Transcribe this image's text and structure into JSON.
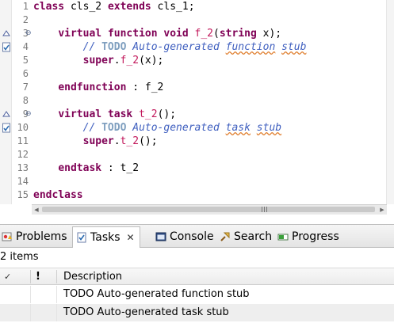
{
  "editor": {
    "lines": [
      {
        "n": "1",
        "segments": [
          {
            "t": "class",
            "c": "kw"
          },
          {
            "t": " cls_2 "
          },
          {
            "t": "extends",
            "c": "kw"
          },
          {
            "t": " cls_1;"
          }
        ]
      },
      {
        "n": "2",
        "segments": []
      },
      {
        "n": "3",
        "segments": [
          {
            "t": "    "
          },
          {
            "t": "virtual",
            "c": "kw"
          },
          {
            "t": " "
          },
          {
            "t": "function",
            "c": "kw"
          },
          {
            "t": " "
          },
          {
            "t": "void",
            "c": "kw"
          },
          {
            "t": " "
          },
          {
            "t": "f_2",
            "c": "fn"
          },
          {
            "t": "("
          },
          {
            "t": "string",
            "c": "kw"
          },
          {
            "t": " x);"
          }
        ]
      },
      {
        "n": "4",
        "segments": [
          {
            "t": "        "
          },
          {
            "t": "// ",
            "c": "cm"
          },
          {
            "t": "TODO",
            "c": "todo"
          },
          {
            "t": " Auto-generated ",
            "c": "cm"
          },
          {
            "t": "function",
            "c": "cm sq"
          },
          {
            "t": " ",
            "c": "cm"
          },
          {
            "t": "stub",
            "c": "cm sq"
          }
        ]
      },
      {
        "n": "5",
        "segments": [
          {
            "t": "        "
          },
          {
            "t": "super",
            "c": "kw"
          },
          {
            "t": "."
          },
          {
            "t": "f_2",
            "c": "fn"
          },
          {
            "t": "(x);"
          }
        ]
      },
      {
        "n": "6",
        "segments": []
      },
      {
        "n": "7",
        "segments": [
          {
            "t": "    "
          },
          {
            "t": "endfunction",
            "c": "kw"
          },
          {
            "t": " : f_2"
          }
        ]
      },
      {
        "n": "8",
        "segments": []
      },
      {
        "n": "9",
        "segments": [
          {
            "t": "    "
          },
          {
            "t": "virtual",
            "c": "kw"
          },
          {
            "t": " "
          },
          {
            "t": "task",
            "c": "kw"
          },
          {
            "t": " "
          },
          {
            "t": "t_2",
            "c": "fn"
          },
          {
            "t": "();"
          }
        ]
      },
      {
        "n": "10",
        "segments": [
          {
            "t": "        "
          },
          {
            "t": "// ",
            "c": "cm"
          },
          {
            "t": "TODO",
            "c": "todo"
          },
          {
            "t": " Auto-generated ",
            "c": "cm"
          },
          {
            "t": "task",
            "c": "cm sq"
          },
          {
            "t": " ",
            "c": "cm"
          },
          {
            "t": "stub",
            "c": "cm sq"
          }
        ]
      },
      {
        "n": "11",
        "segments": [
          {
            "t": "        "
          },
          {
            "t": "super",
            "c": "kw"
          },
          {
            "t": "."
          },
          {
            "t": "t_2",
            "c": "fn"
          },
          {
            "t": "();"
          }
        ]
      },
      {
        "n": "12",
        "segments": []
      },
      {
        "n": "13",
        "segments": [
          {
            "t": "    "
          },
          {
            "t": "endtask",
            "c": "kw"
          },
          {
            "t": " : t_2"
          }
        ]
      },
      {
        "n": "14",
        "segments": []
      },
      {
        "n": "15",
        "segments": [
          {
            "t": "endclass",
            "c": "kw"
          }
        ]
      }
    ]
  },
  "tabs": [
    {
      "label": "Problems",
      "icon": "problems-icon"
    },
    {
      "label": "Tasks",
      "icon": "tasks-icon",
      "active": true
    },
    {
      "label": "Console",
      "icon": "console-icon"
    },
    {
      "label": "Search",
      "icon": "search-icon"
    },
    {
      "label": "Progress",
      "icon": "progress-icon"
    }
  ],
  "tasks": {
    "count_label": "2 items",
    "columns": {
      "check": "✓",
      "priority": "!",
      "description": "Description"
    },
    "rows": [
      {
        "description": "TODO Auto-generated function stub"
      },
      {
        "description": "TODO Auto-generated task stub"
      }
    ]
  },
  "colors": {
    "keyword": "#7f0055",
    "method": "#c2185b",
    "comment": "#3f5fbf",
    "todo": "#7f9fbf"
  }
}
